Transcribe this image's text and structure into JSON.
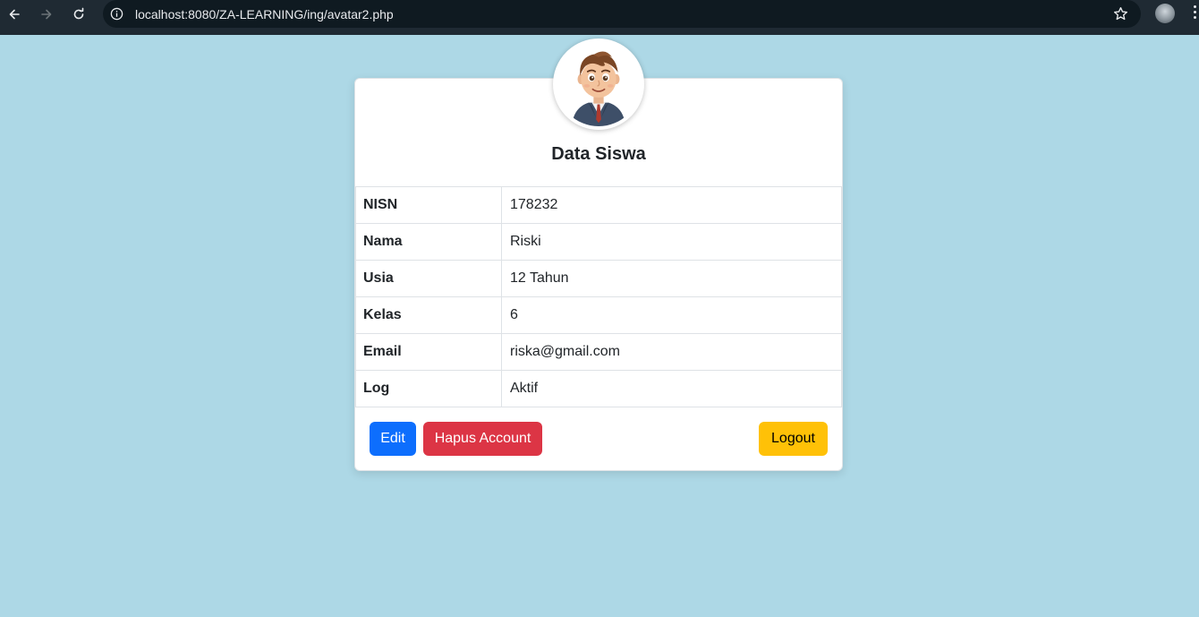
{
  "browser": {
    "url": "localhost:8080/ZA-LEARNING/ing/avatar2.php",
    "back_icon": "arrow-left-icon",
    "forward_icon": "arrow-right-icon",
    "reload_icon": "reload-icon",
    "site_info_icon": "info-icon",
    "bookmark_icon": "star-icon",
    "menu_icon": "more-vert-icon"
  },
  "card": {
    "title": "Data Siswa",
    "avatar_icon": "cartoon-boy-avatar",
    "rows": [
      {
        "label": "NISN",
        "value": "178232"
      },
      {
        "label": "Nama",
        "value": "Riski"
      },
      {
        "label": "Usia",
        "value": "12 Tahun"
      },
      {
        "label": "Kelas",
        "value": "6"
      },
      {
        "label": "Email",
        "value": "riska@gmail.com"
      },
      {
        "label": "Log",
        "value": "Aktif"
      }
    ],
    "buttons": {
      "edit": "Edit",
      "delete": "Hapus Account",
      "logout": "Logout"
    }
  },
  "colors": {
    "page_background": "#add8e6",
    "edit_button": "#0d6efd",
    "delete_button": "#dc3545",
    "logout_button": "#ffc107"
  }
}
